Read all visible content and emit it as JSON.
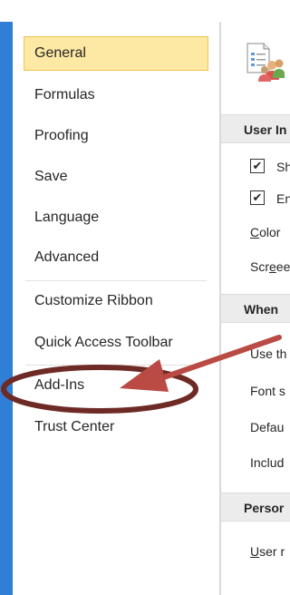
{
  "sidebar": {
    "items": [
      {
        "label": "General",
        "selected": true
      },
      {
        "label": "Formulas"
      },
      {
        "label": "Proofing"
      },
      {
        "label": "Save"
      },
      {
        "label": "Language"
      },
      {
        "label": "Advanced"
      },
      {
        "label": "Customize Ribbon"
      },
      {
        "label": "Quick Access Toolbar"
      },
      {
        "label": "Add-Ins"
      },
      {
        "label": "Trust Center"
      }
    ]
  },
  "content": {
    "sections": [
      {
        "label": "User In"
      },
      {
        "label": "When"
      },
      {
        "label": "Persor"
      }
    ],
    "checkboxes": [
      {
        "label": "Sh",
        "checked": true
      },
      {
        "label": "En",
        "checked": true
      }
    ],
    "rows": {
      "color": {
        "pre": "",
        "u": "C",
        "post": "olor"
      },
      "screen": {
        "pre": "Scr",
        "u": "e",
        "post": "een"
      },
      "use_the": "Use th",
      "font_size": "Font s",
      "default": "Defau",
      "include": "Includ",
      "user_name": {
        "pre": "",
        "u": "U",
        "post": "ser r"
      }
    },
    "check_mark": "✔",
    "hero_icon": "options-general-icon"
  },
  "colors": {
    "selected_bg": "#fde9a4",
    "selected_border": "#f0c34b",
    "window_border": "#2f7fd6",
    "annotation": "#9b3b2e",
    "arrow": "#c0504d"
  }
}
